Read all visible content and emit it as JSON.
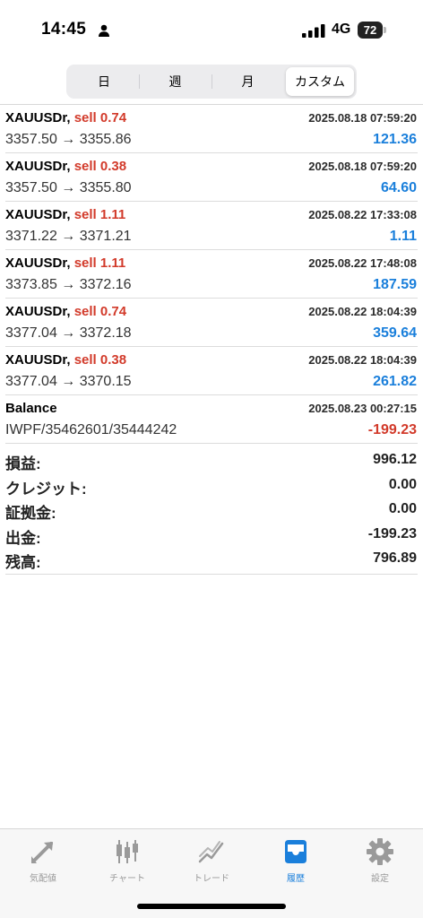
{
  "status_bar": {
    "time": "14:45",
    "network": "4G",
    "battery": "72"
  },
  "period_tabs": [
    "日",
    "週",
    "月",
    "カスタム"
  ],
  "selected_period": "カスタム",
  "trades": [
    {
      "symbol": "XAUUSDr,",
      "side": "sell 0.74",
      "time": "2025.08.18 07:59:20",
      "prices": "3357.50 → 3355.86",
      "profit": "121.36"
    },
    {
      "symbol": "XAUUSDr,",
      "side": "sell 0.38",
      "time": "2025.08.18 07:59:20",
      "prices": "3357.50 → 3355.80",
      "profit": "64.60"
    },
    {
      "symbol": "XAUUSDr,",
      "side": "sell 1.11",
      "time": "2025.08.22 17:33:08",
      "prices": "3371.22 → 3371.21",
      "profit": "1.11"
    },
    {
      "symbol": "XAUUSDr,",
      "side": "sell 1.11",
      "time": "2025.08.22 17:48:08",
      "prices": "3373.85 → 3372.16",
      "profit": "187.59"
    },
    {
      "symbol": "XAUUSDr,",
      "side": "sell 0.74",
      "time": "2025.08.22 18:04:39",
      "prices": "3377.04 → 3372.18",
      "profit": "359.64"
    },
    {
      "symbol": "XAUUSDr,",
      "side": "sell 0.38",
      "time": "2025.08.22 18:04:39",
      "prices": "3377.04 → 3370.15",
      "profit": "261.82"
    }
  ],
  "balance_entry": {
    "label": "Balance",
    "time": "2025.08.23 00:27:15",
    "comment": "IWPF/35462601/35444242",
    "amount": "-199.23"
  },
  "summary": [
    {
      "label": "損益:",
      "value": "996.12"
    },
    {
      "label": "クレジット:",
      "value": "0.00"
    },
    {
      "label": "証拠金:",
      "value": "0.00"
    },
    {
      "label": "出金:",
      "value": "-199.23"
    },
    {
      "label": "残高:",
      "value": "796.89"
    }
  ],
  "tab_bar": [
    {
      "label": "気配値",
      "icon": "quotes-icon"
    },
    {
      "label": "チャート",
      "icon": "chart-icon"
    },
    {
      "label": "トレード",
      "icon": "trade-icon"
    },
    {
      "label": "履歴",
      "icon": "history-icon"
    },
    {
      "label": "設定",
      "icon": "settings-icon"
    }
  ],
  "active_tab": "履歴",
  "colors": {
    "accent": "#1a7fdb",
    "sell": "#d23a2a",
    "negative": "#d23a2a",
    "positive": "#1a7fdb"
  }
}
